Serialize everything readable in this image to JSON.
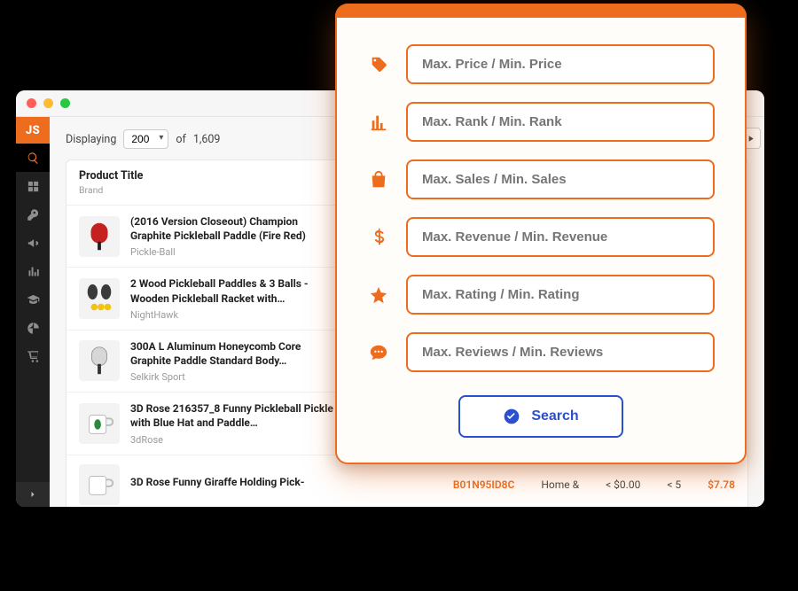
{
  "sidebar": {
    "logo": "JS"
  },
  "toolbar": {
    "displaying_label": "Displaying",
    "page_size": "200",
    "of_label": "of",
    "total": "1,609"
  },
  "table": {
    "header_title": "Product Title",
    "header_sub": "Brand",
    "rows": [
      {
        "title": "(2016 Version Closeout) Champion Graphite Pickleball Paddle (Fire Red)",
        "brand": "Pickle-Ball"
      },
      {
        "title": "2 Wood Pickleball Paddles & 3 Balls - Wooden Pickleball Racket with…",
        "brand": "NightHawk"
      },
      {
        "title": "300A L Aluminum Honeycomb Core Graphite Paddle Standard Body…",
        "brand": "Selkirk Sport"
      },
      {
        "title": "3D Rose 216357_8 Funny Pickleball Pickle with Blue Hat and Paddle…",
        "brand": "3dRose"
      },
      {
        "title": "3D Rose Funny Giraffe Holding Pick-",
        "brand": ""
      }
    ],
    "last_row_metrics": {
      "asin": "B01N95ID8C",
      "category": "Home &",
      "sales": "< $0.00",
      "units": "< 5",
      "price": "$7.78"
    }
  },
  "filters": {
    "rows": [
      {
        "placeholder": "Max. Price / Min. Price",
        "icon": "tag"
      },
      {
        "placeholder": "Max. Rank / Min. Rank",
        "icon": "chart"
      },
      {
        "placeholder": "Max. Sales / Min. Sales",
        "icon": "bag"
      },
      {
        "placeholder": "Max. Revenue / Min. Revenue",
        "icon": "dollar"
      },
      {
        "placeholder": "Max. Rating / Min. Rating",
        "icon": "star"
      },
      {
        "placeholder": "Max. Reviews / Min. Reviews",
        "icon": "speech"
      }
    ],
    "search_label": "Search"
  }
}
